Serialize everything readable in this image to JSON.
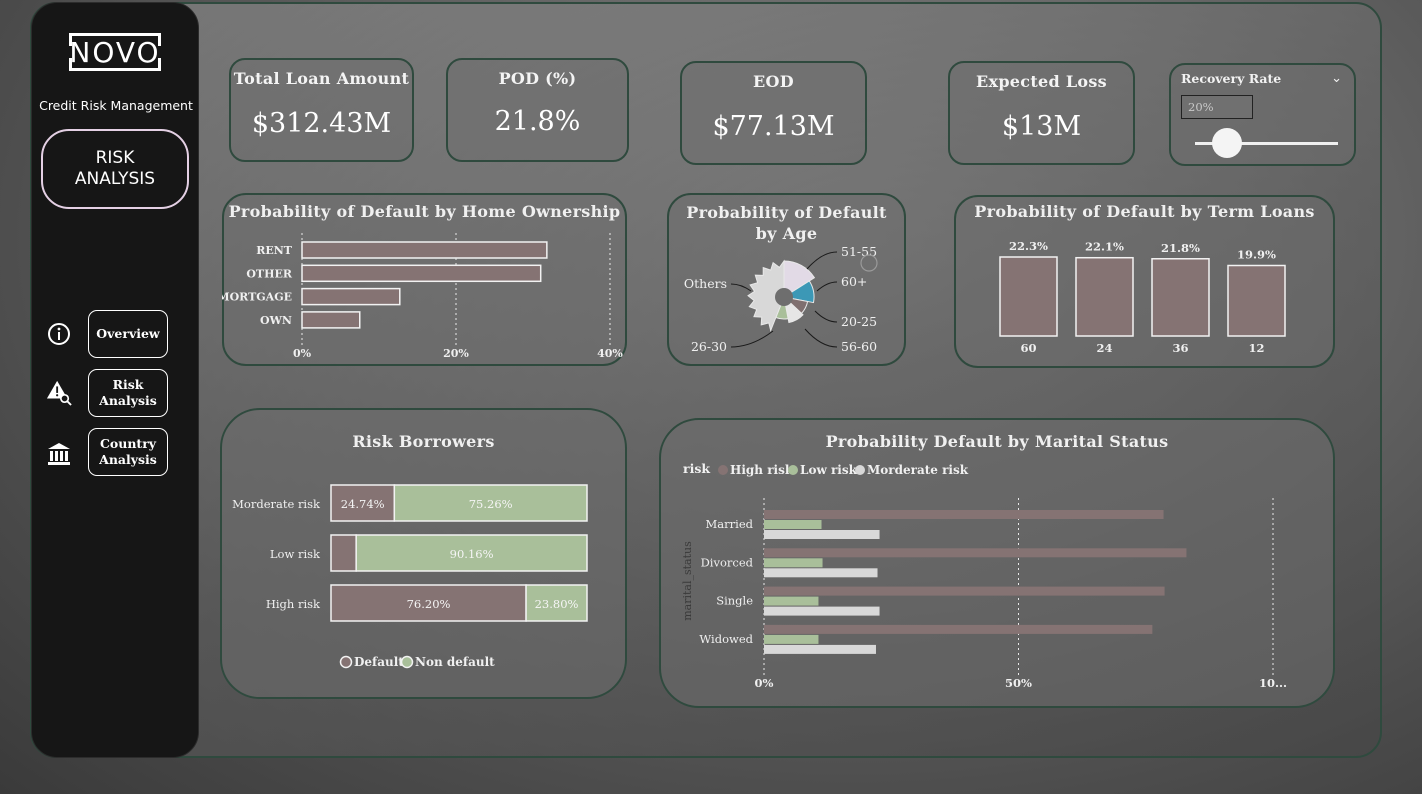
{
  "sidebar": {
    "logo": "NOVO",
    "subtitle": "Credit Risk Management",
    "page_title_line1": "RISK",
    "page_title_line2": "ANALYSIS",
    "nav": [
      {
        "line1": "Overview",
        "line2": "",
        "icon": "info-circle-icon"
      },
      {
        "line1": "Risk",
        "line2": "Analysis",
        "icon": "warning-search-icon"
      },
      {
        "line1": "Country",
        "line2": "Analysis",
        "icon": "bank-icon"
      }
    ]
  },
  "kpis": [
    {
      "title": "Total Loan Amount",
      "value": "$312.43M"
    },
    {
      "title": "POD (%)",
      "value": "21.8%"
    },
    {
      "title": "EOD",
      "value": "$77.13M"
    },
    {
      "title": "Expected Loss",
      "value": "$13M"
    }
  ],
  "slicer": {
    "title": "Recovery Rate",
    "value": "20%",
    "level": 0.2
  },
  "charts": {
    "home_ownership": {
      "title": "Probability of Default by Home Ownership",
      "chart_data": {
        "type": "bar",
        "orientation": "horizontal",
        "categories": [
          "RENT",
          "OTHER",
          "MORTGAGE",
          "OWN"
        ],
        "values": [
          31.8,
          31.0,
          12.7,
          7.5
        ],
        "xlim": [
          0,
          40
        ],
        "ticks": [
          "0%",
          "20%",
          "40%"
        ],
        "bar_color": "#857373"
      }
    },
    "age": {
      "title_line1": "Probability of Default",
      "title_line2": "by Age",
      "chart_data": {
        "type": "pie",
        "variant": "rose",
        "labels": [
          "51-55",
          "60+",
          "20-25",
          "56-60",
          "26-30",
          "Others"
        ],
        "values": [
          16,
          12,
          9,
          10,
          9,
          44
        ],
        "colors": [
          "#e2dae6",
          "#3c98b6",
          "#7f6f6f",
          "#e6e6e6",
          "#a9bf9a",
          "#d8d8d8"
        ]
      }
    },
    "term": {
      "title": "Probability of Default by Term Loans",
      "chart_data": {
        "type": "bar",
        "categories": [
          "60",
          "24",
          "36",
          "12"
        ],
        "values": [
          22.3,
          22.1,
          21.8,
          19.9
        ],
        "data_labels": [
          "22.3%",
          "22.1%",
          "21.8%",
          "19.9%"
        ],
        "bar_color": "#857373"
      }
    },
    "borrowers": {
      "title": "Risk Borrowers",
      "chart_data": {
        "type": "bar",
        "variant": "100% stacked horizontal",
        "categories": [
          "Morderate risk",
          "Low risk",
          "High risk"
        ],
        "series": [
          {
            "name": "Default",
            "values": [
              24.74,
              9.84,
              76.2
            ],
            "labels": [
              "24.74%",
              "",
              "76.20%"
            ],
            "color": "#857373"
          },
          {
            "name": "Non default",
            "values": [
              75.26,
              90.16,
              23.8
            ],
            "labels": [
              "75.26%",
              "90.16%",
              "23.80%"
            ],
            "color": "#a9bf9a"
          }
        ]
      }
    },
    "marital": {
      "title": "Probability Default by Marital Status",
      "legend_title": "risk",
      "y_axis_label": "marital_status",
      "chart_data": {
        "type": "bar",
        "orientation": "horizontal",
        "categories": [
          "Married",
          "Divorced",
          "Single",
          "Widowed"
        ],
        "series": [
          {
            "name": "High risk",
            "values": [
              78.5,
              83.0,
              78.7,
              76.3
            ],
            "color": "#857373"
          },
          {
            "name": "Low risk",
            "values": [
              11.3,
              11.5,
              10.7,
              10.7
            ],
            "color": "#a9bf9a"
          },
          {
            "name": "Morderate risk",
            "values": [
              22.7,
              22.3,
              22.7,
              22.0
            ],
            "color": "#d8d8d8"
          }
        ],
        "xlim": [
          0,
          100
        ],
        "ticks": [
          "0%",
          "50%",
          "10..."
        ]
      }
    }
  }
}
